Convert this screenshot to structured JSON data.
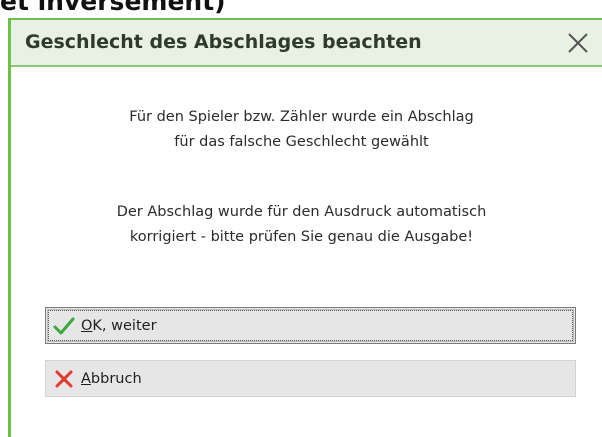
{
  "background_heading": {
    "text": "et inversement)"
  },
  "dialog": {
    "title": "Geschlecht des Abschlages beachten",
    "accent_color": "#6cc04a",
    "title_bg_color": "#e9f1e4",
    "close_icon": "close-icon",
    "message_1": {
      "line_1": "Für den Spieler bzw. Zähler wurde ein Abschlag",
      "line_2": "für das falsche Geschlecht gewählt"
    },
    "message_2": {
      "line_1": "Der Abschlag wurde für den Ausdruck automatisch",
      "line_2": "korrigiert - bitte prüfen Sie genau die Ausgabe!"
    },
    "buttons": {
      "ok": {
        "mnemonic": "O",
        "rest": "K, weiter",
        "icon": "check-icon",
        "icon_color": "#3aa83a",
        "focused": true
      },
      "cancel": {
        "mnemonic": "A",
        "rest": "bbruch",
        "icon": "x-icon",
        "icon_color": "#e03a2e"
      }
    }
  }
}
